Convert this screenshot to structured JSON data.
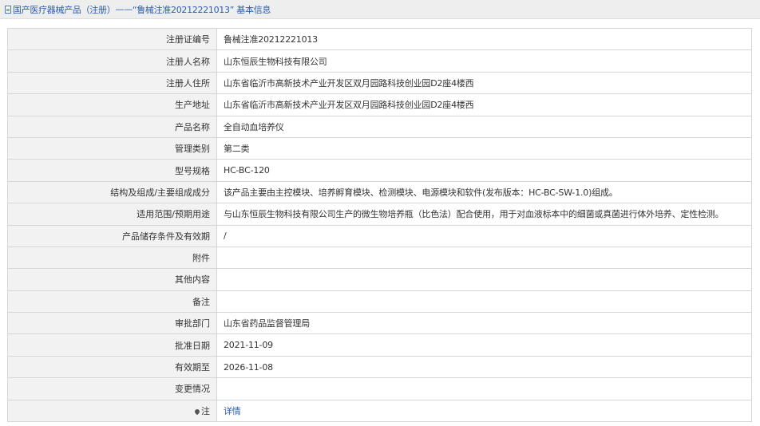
{
  "breadcrumb": {
    "part1": "国产医疗器械产品（注册）",
    "separator": " —— ",
    "part2": "“鲁械注准20212221013” 基本信息"
  },
  "rows": [
    {
      "label": "注册证编号",
      "value": "鲁械注准20212221013"
    },
    {
      "label": "注册人名称",
      "value": "山东恒辰生物科技有限公司"
    },
    {
      "label": "注册人住所",
      "value": "山东省临沂市高新技术产业开发区双月园路科技创业园D2座4楼西"
    },
    {
      "label": "生产地址",
      "value": "山东省临沂市高新技术产业开发区双月园路科技创业园D2座4楼西"
    },
    {
      "label": "产品名称",
      "value": "全自动血培养仪"
    },
    {
      "label": "管理类别",
      "value": "第二类"
    },
    {
      "label": "型号规格",
      "value": "HC-BC-120"
    },
    {
      "label": "结构及组成/主要组成成分",
      "value": "该产品主要由主控模块、培养孵育模块、检测模块、电源模块和软件(发布版本：HC-BC-SW-1.0)组成。"
    },
    {
      "label": "适用范围/预期用途",
      "value": "与山东恒辰生物科技有限公司生产的微生物培养瓶（比色法）配合使用，用于对血液标本中的细菌或真菌进行体外培养、定性检测。"
    },
    {
      "label": "产品储存条件及有效期",
      "value": "/"
    },
    {
      "label": "附件",
      "value": ""
    },
    {
      "label": "其他内容",
      "value": ""
    },
    {
      "label": "备注",
      "value": ""
    },
    {
      "label": "审批部门",
      "value": "山东省药品监督管理局"
    },
    {
      "label": "批准日期",
      "value": "2021-11-09"
    },
    {
      "label": "有效期至",
      "value": "2026-11-08"
    },
    {
      "label": "变更情况",
      "value": ""
    }
  ],
  "note_row": {
    "icon": "pin-icon",
    "label": "注",
    "link": "详情"
  },
  "colors": {
    "link": "#2a5da8",
    "label_bg": "#f2f2f2",
    "border": "#d6d6d6",
    "topbar_bg": "#eeeeee"
  }
}
